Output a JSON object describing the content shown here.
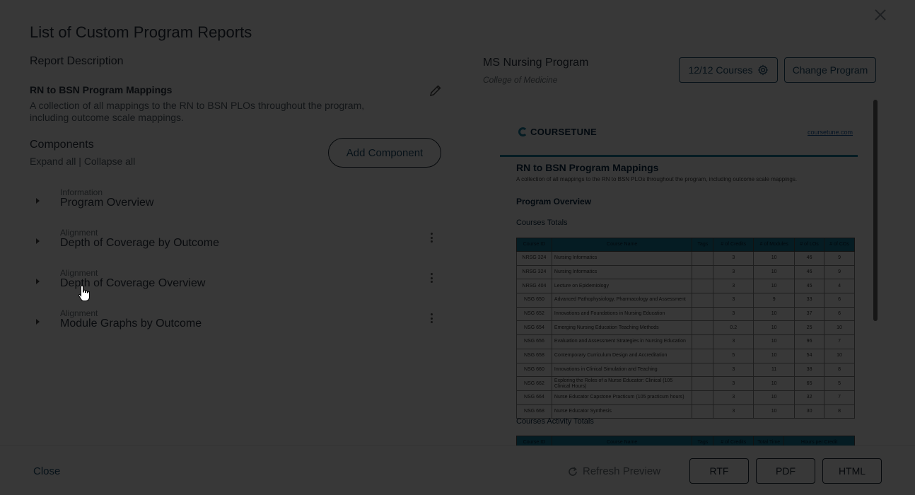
{
  "modal": {
    "title": "List of Custom Program Reports"
  },
  "report": {
    "section_title": "Report Description",
    "name": "RN to BSN Program Mappings",
    "description": "A collection of all mappings to the RN to BSN PLOs throughout the program, including outcome scale mappings."
  },
  "components": {
    "section_title": "Components",
    "expand_all": "Expand all",
    "separator": " | ",
    "collapse_all": "Collapse all",
    "add_button": "Add Component",
    "items": [
      {
        "type": "Information",
        "name": "Program Overview"
      },
      {
        "type": "Alignment",
        "name": "Depth of Coverage by Outcome"
      },
      {
        "type": "Alignment",
        "name": "Depth of Coverage Overview"
      },
      {
        "type": "Alignment",
        "name": "Module Graphs by Outcome"
      }
    ]
  },
  "program": {
    "name": "MS Nursing Program",
    "college": "College of Medicine",
    "courses_button": "12/12 Courses",
    "change_button": "Change Program"
  },
  "preview": {
    "brand": "COURSETUNE",
    "link": "coursetune.com",
    "title": "RN to BSN Program Mappings",
    "subtitle": "A collection of all mappings to the RN to BSN PLOs throughout the program, including outcome scale mappings.",
    "section": "Program Overview",
    "courses_totals": "Courses Totals",
    "activity_totals": "Courses Activity Totals",
    "table_headers": [
      "Course ID",
      "Course Name",
      "Tags",
      "# of Credits",
      "# of Modules",
      "# of LOs",
      "# of COs"
    ],
    "rows": [
      [
        "NRSG 324",
        "Nursing Informatics",
        "",
        "3",
        "10",
        "46",
        "9"
      ],
      [
        "NRSG 324",
        "Nursing Informatics",
        "",
        "3",
        "10",
        "46",
        "9"
      ],
      [
        "NRSG 404",
        "Lecture on Epidemiology",
        "",
        "3",
        "10",
        "45",
        "4"
      ],
      [
        "NSG 650",
        "Advanced Pathophysiology, Pharmacology and Assessment",
        "",
        "3",
        "9",
        "33",
        "6"
      ],
      [
        "NSG 652",
        "Innovations and Foundations in Nursing Education",
        "",
        "3",
        "10",
        "37",
        "6"
      ],
      [
        "NSG 654",
        "Emerging Nursing Education Teaching Methods",
        "",
        "0.2",
        "10",
        "25",
        "10"
      ],
      [
        "NSG 656",
        "Evaluation and Assessment Strategies in Nursing Education",
        "",
        "3",
        "10",
        "96",
        "7"
      ],
      [
        "NSG 658",
        "Contemporary Curriculum Design and Accreditation",
        "",
        "5",
        "10",
        "54",
        "10"
      ],
      [
        "NSG 660",
        "Innovations in Clinical Simulation and Teaching",
        "",
        "3",
        "11",
        "38",
        "8"
      ],
      [
        "NSG 662",
        "Exploring the Roles of a Nurse Educator: Clinical (105 Clinical Hours)",
        "",
        "3",
        "10",
        "65",
        "5"
      ],
      [
        "NSG 664",
        "Nurse Educator Capstone Practicum (105 practicum hours)",
        "",
        "3",
        "10",
        "32",
        "7"
      ],
      [
        "NSG 668",
        "Nurse Educator Synthesis",
        "",
        "3",
        "10",
        "30",
        "8"
      ]
    ],
    "activity_headers": [
      "Course ID",
      "Course Name",
      "Tags",
      "# of Credits",
      "Total Time",
      "Hours per Credit"
    ]
  },
  "footer": {
    "close": "Close",
    "refresh": "Refresh Preview",
    "rtf": "RTF",
    "pdf": "PDF",
    "html": "HTML"
  }
}
